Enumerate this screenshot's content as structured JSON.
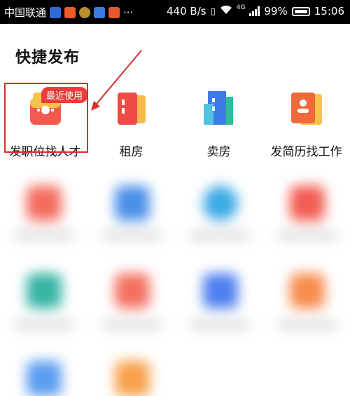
{
  "status_bar": {
    "carrier": "中国联通",
    "dots": "···",
    "speed": "440 B/s",
    "network": "4G",
    "battery": "99%",
    "time": "15:06"
  },
  "section_title": "快捷发布",
  "badge": "最近使用",
  "items": [
    {
      "label": "发职位找人才"
    },
    {
      "label": "租房"
    },
    {
      "label": "卖房"
    },
    {
      "label": "发简历找工作"
    }
  ],
  "colors": {
    "accent_red": "#ef3b3b",
    "highlight_border": "#d0312d"
  }
}
